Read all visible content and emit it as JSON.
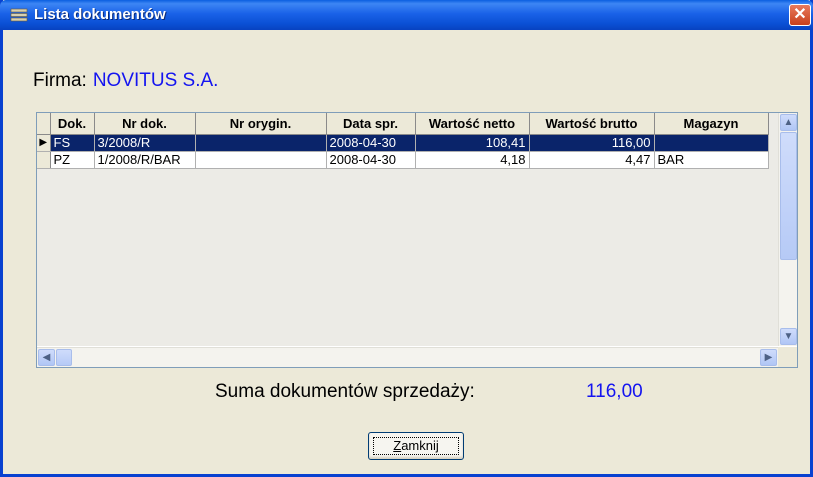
{
  "window": {
    "title": "Lista dokumentów"
  },
  "firma": {
    "label": "Firma:",
    "value": "NOVITUS S.A."
  },
  "table": {
    "columns": [
      "Dok.",
      "Nr dok.",
      "Nr orygin.",
      "Data spr.",
      "Wartość netto",
      "Wartość brutto",
      "Magazyn"
    ],
    "rows": [
      {
        "dok": "FS",
        "nr_dok": "3/2008/R",
        "nr_orygin": "",
        "data_spr": "2008-04-30",
        "netto": "108,41",
        "brutto": "116,00",
        "magazyn": ""
      },
      {
        "dok": "PZ",
        "nr_dok": "1/2008/R/BAR",
        "nr_orygin": "",
        "data_spr": "2008-04-30",
        "netto": "4,18",
        "brutto": "4,47",
        "magazyn": "BAR"
      }
    ]
  },
  "summary": {
    "label": "Suma dokumentów sprzedaży:",
    "value": "116,00"
  },
  "buttons": {
    "close_label": "Zamknij",
    "close_mnemonic": "Z",
    "close_rest": "amknij"
  },
  "icons": {
    "title_icon": "list-window-icon",
    "close_icon": "close-icon"
  },
  "colors": {
    "title_bar": "#0a4fd4",
    "value_text": "#1414f0",
    "selection": "#0a246a"
  }
}
